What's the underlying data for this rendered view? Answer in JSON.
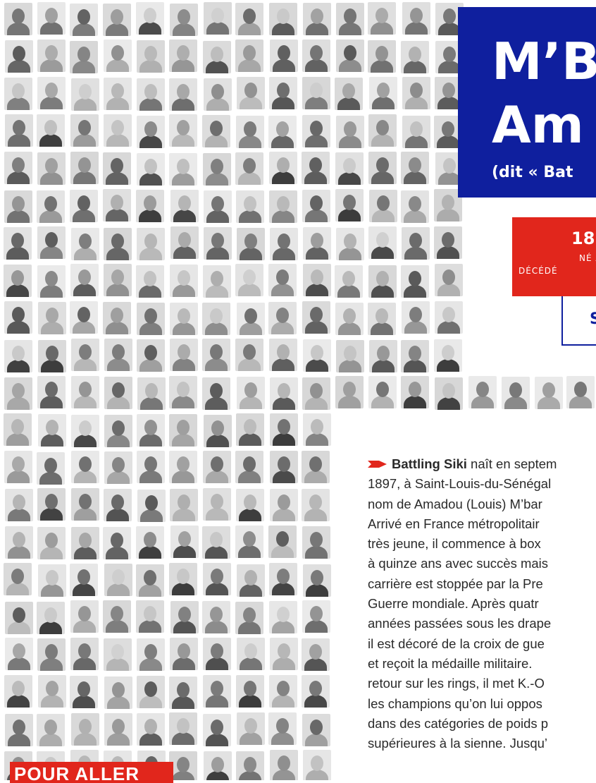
{
  "title": {
    "name_line1": "M’B",
    "name_line2": "Am",
    "nickname": "(dit « Bat"
  },
  "dates": {
    "years": "18",
    "born": "NÉ A",
    "died": "DÉCÉDÉ"
  },
  "tag": {
    "text": "S"
  },
  "body": {
    "lead": "Battling Siki",
    "lines": [
      " naît en septem",
      "1897, à Saint-Louis-du-Sénégal",
      "nom de Amadou (Louis) M’bar",
      "Arrivé en France métropolitair",
      "très jeune, il commence à box",
      "à quinze ans avec succès mais",
      "carrière est stoppée par la Pre",
      "Guerre mondiale. Après quatr",
      "années passées sous les drape",
      "il est décoré de la croix de gue",
      "et reçoit la médaille militaire.",
      "retour sur les rings, il met K.-O",
      "les champions qu’on lui oppos",
      "dans des catégories de poids p",
      "supérieures à la sienne. Jusqu’"
    ]
  },
  "footer": {
    "label": "POUR ALLER"
  },
  "colors": {
    "blue": "#0f1f9e",
    "red": "#e1261c",
    "text": "#2a2a2a",
    "mosaic_light": "#dcdcdc",
    "mosaic_dark": "#8a8a8a"
  },
  "icons": {
    "bullet": "red-arrow-bullet-icon"
  }
}
